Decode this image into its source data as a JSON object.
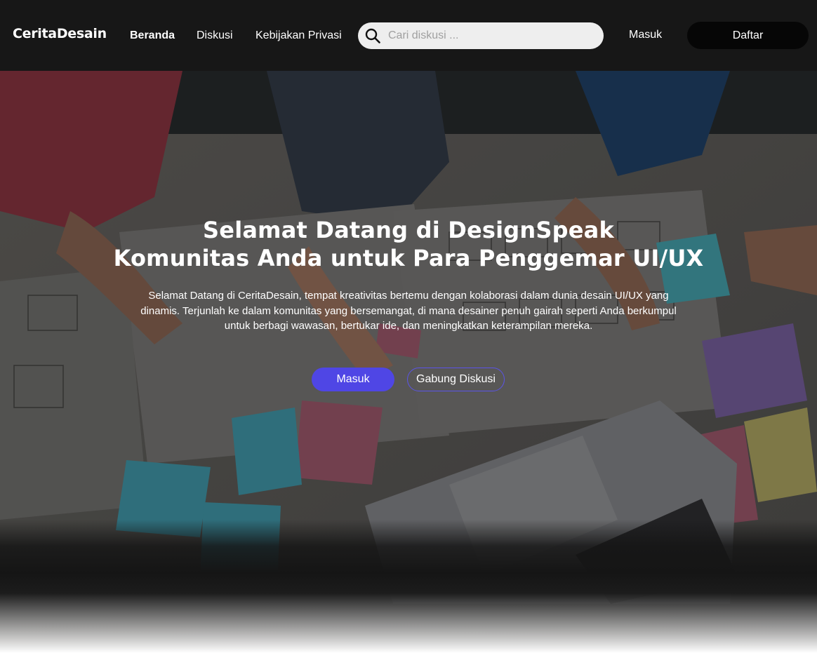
{
  "brand": {
    "name": "CeritaDesain"
  },
  "nav": {
    "links": [
      {
        "label": "Beranda",
        "active": true
      },
      {
        "label": "Diskusi",
        "active": false
      },
      {
        "label": "Kebijakan Privasi",
        "active": false
      }
    ],
    "search": {
      "placeholder": "Cari diskusi ...",
      "value": "",
      "icon": "search-icon"
    },
    "login_label": "Masuk",
    "signup_label": "Daftar"
  },
  "hero": {
    "title_line1": "Selamat Datang di DesignSpeak",
    "title_line2": "Komunitas Anda untuk Para Penggemar UI/UX",
    "description": "Selamat Datang di CeritaDesain, tempat kreativitas bertemu dengan kolaborasi dalam dunia desain UI/UX yang dinamis. Terjunlah ke dalam komunitas yang bersemangat, di mana desainer penuh gairah seperti Anda berkumpul untuk berbagi wawasan, bertukar ide, dan meningkatkan keterampilan mereka.",
    "primary_button": "Masuk",
    "secondary_button": "Gabung Diskusi"
  },
  "colors": {
    "navbar_bg": "#171717",
    "accent": "#4f46e5",
    "signup_bg": "#060606",
    "search_bg": "#eeeeee"
  }
}
